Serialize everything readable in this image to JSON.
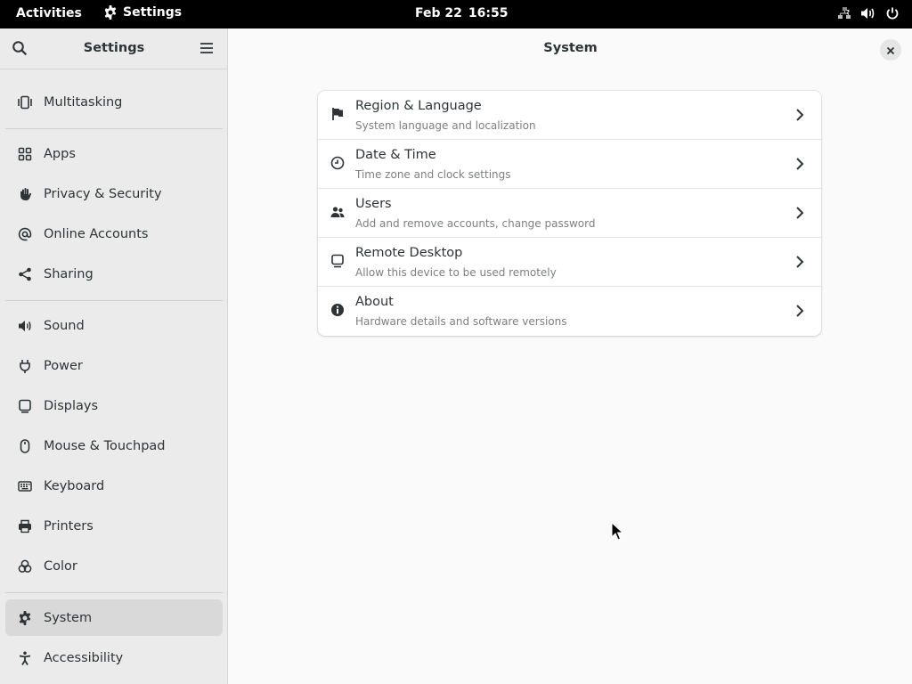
{
  "topbar": {
    "activities": "Activities",
    "app_name": "Settings",
    "date": "Feb 22",
    "time": "16:55",
    "tray_icons": [
      "network-icon",
      "volume-icon",
      "power-icon"
    ]
  },
  "sidebar": {
    "title": "Settings",
    "items": [
      {
        "label": "Multitasking",
        "icon": "multitasking-icon"
      },
      {
        "label": "Apps",
        "icon": "apps-grid-icon"
      },
      {
        "label": "Privacy & Security",
        "icon": "hand-icon"
      },
      {
        "label": "Online Accounts",
        "icon": "at-sign-icon"
      },
      {
        "label": "Sharing",
        "icon": "share-icon"
      },
      {
        "label": "Sound",
        "icon": "speaker-icon"
      },
      {
        "label": "Power",
        "icon": "plug-icon"
      },
      {
        "label": "Displays",
        "icon": "monitor-icon"
      },
      {
        "label": "Mouse & Touchpad",
        "icon": "mouse-icon"
      },
      {
        "label": "Keyboard",
        "icon": "keyboard-icon"
      },
      {
        "label": "Printers",
        "icon": "printer-icon"
      },
      {
        "label": "Color",
        "icon": "color-icon"
      },
      {
        "label": "System",
        "icon": "gear-icon",
        "selected": true
      },
      {
        "label": "Accessibility",
        "icon": "accessibility-icon"
      }
    ]
  },
  "main": {
    "title": "System",
    "rows": [
      {
        "title": "Region & Language",
        "subtitle": "System language and localization",
        "icon": "flag-icon"
      },
      {
        "title": "Date & Time",
        "subtitle": "Time zone and clock settings",
        "icon": "clock-icon"
      },
      {
        "title": "Users",
        "subtitle": "Add and remove accounts, change password",
        "icon": "users-icon"
      },
      {
        "title": "Remote Desktop",
        "subtitle": "Allow this device to be used remotely",
        "icon": "remote-desktop-icon"
      },
      {
        "title": "About",
        "subtitle": "Hardware details and software versions",
        "icon": "info-icon"
      }
    ]
  },
  "colors": {
    "topbar_bg": "#000000",
    "sidebar_bg": "#ebebeb",
    "selected_bg": "#d9d9d9",
    "content_bg": "#fafafa",
    "card_bg": "#ffffff",
    "text": "#2e3436",
    "subtext": "#7d7f80"
  }
}
